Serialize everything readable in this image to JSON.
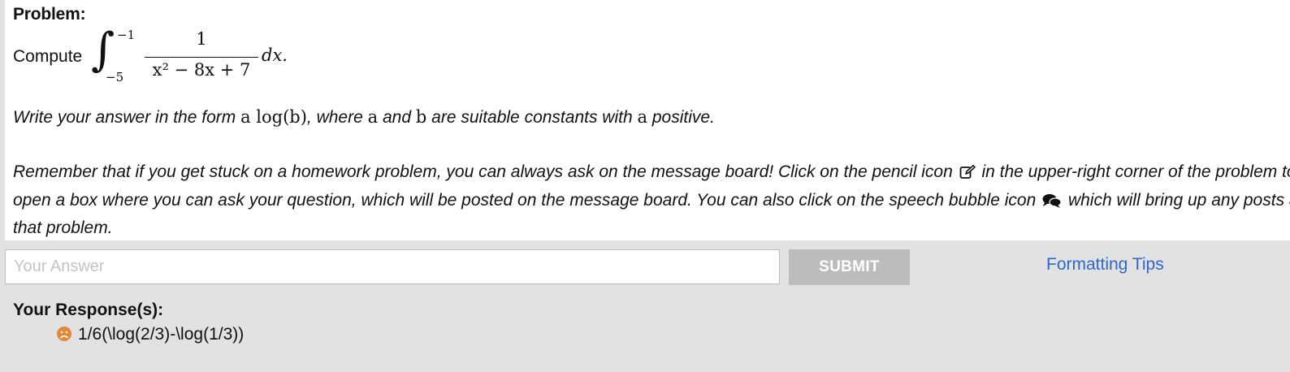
{
  "problem": {
    "title": "Problem:",
    "compute_word": "Compute",
    "integral": {
      "sign": "∫",
      "upper_limit": "−1",
      "lower_limit": "−5",
      "numerator": "1",
      "denominator": "x² − 8x + 7",
      "differential": "dx."
    },
    "form_instruction": {
      "prefix": "Write your answer in the form ",
      "form_expr": "a log(b)",
      "middle1": ", where ",
      "var_a": "a",
      "middle2": " and ",
      "var_b": "b",
      "middle3": " are suitable constants with ",
      "var_a2": "a",
      "suffix": " positive."
    },
    "remember": {
      "line1_a": "Remember that if you get stuck on a homework problem, you can always ask on the message board! Click on the pencil icon",
      "line1_b": " in the upper-right corner of the problem to",
      "line2_a": "open a box where you can ask your question, which will be posted on the message board. You can also click on the speech bubble icon",
      "line2_b": " which will bring up any posts about",
      "line3": "that problem."
    },
    "icons": {
      "pencil": "pencil-edit-icon",
      "speech": "speech-bubble-icon",
      "response_status": "sad-face-icon"
    }
  },
  "answer_form": {
    "placeholder": "Your Answer",
    "value": "",
    "submit_label": "SUBMIT",
    "formatting_tips_label": "Formatting Tips"
  },
  "responses": {
    "title": "Your Response(s):",
    "items": [
      {
        "text": "1/6(\\log(2/3)-\\log(1/3))",
        "status": "incorrect"
      }
    ]
  },
  "colors": {
    "page_background": "#e2e2e2",
    "panel_background": "#ffffff",
    "submit_background": "#bcbcbc",
    "link": "#2f68c8",
    "incorrect_status": "#e5883a"
  }
}
